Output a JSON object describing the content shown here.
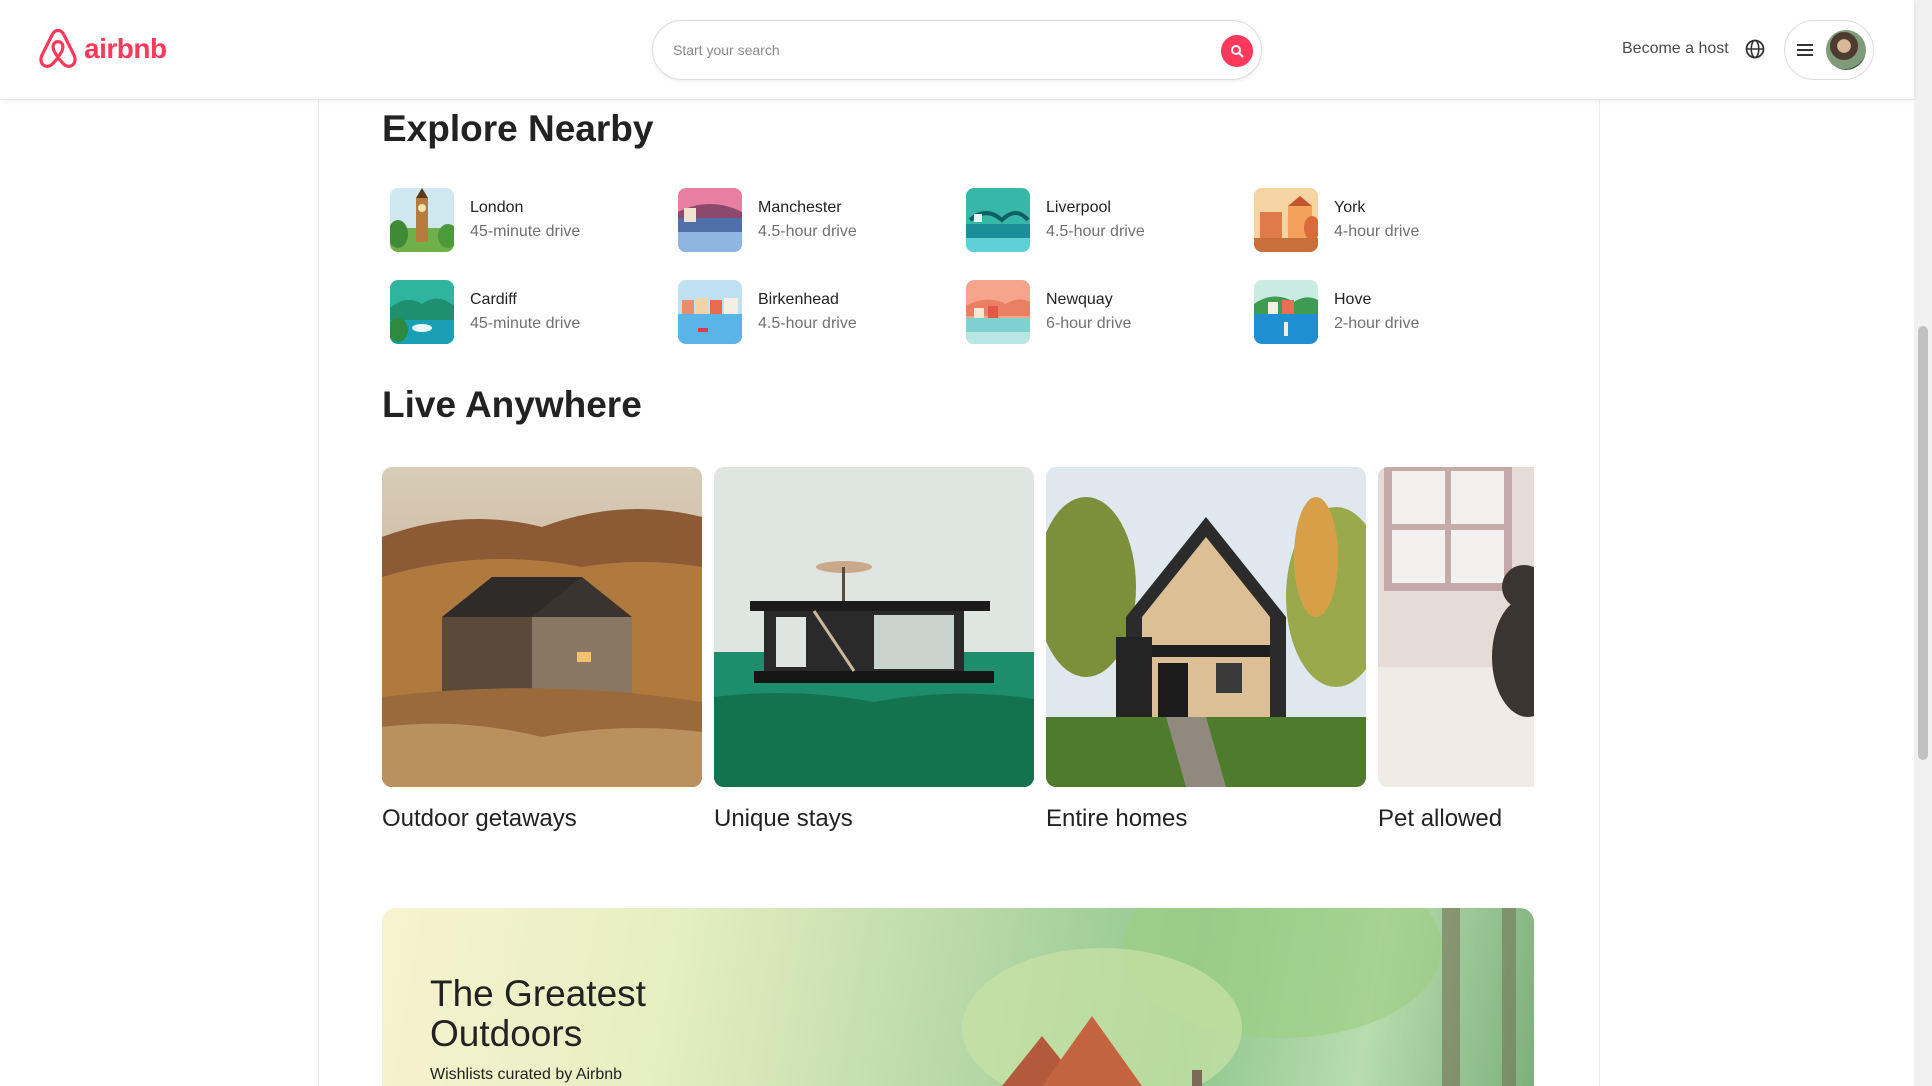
{
  "header": {
    "logo_text": "airbnb",
    "search_placeholder": "Start your search",
    "host_link": "Become a host"
  },
  "explore": {
    "title": "Explore Nearby",
    "items": [
      {
        "city": "London",
        "drive": "45-minute drive"
      },
      {
        "city": "Manchester",
        "drive": "4.5-hour drive"
      },
      {
        "city": "Liverpool",
        "drive": "4.5-hour drive"
      },
      {
        "city": "York",
        "drive": "4-hour drive"
      },
      {
        "city": "Cardiff",
        "drive": "45-minute drive"
      },
      {
        "city": "Birkenhead",
        "drive": "4.5-hour drive"
      },
      {
        "city": "Newquay",
        "drive": "6-hour drive"
      },
      {
        "city": "Hove",
        "drive": "2-hour drive"
      }
    ]
  },
  "live": {
    "title": "Live Anywhere",
    "cards": [
      {
        "label": "Outdoor getaways"
      },
      {
        "label": "Unique stays"
      },
      {
        "label": "Entire homes"
      },
      {
        "label": "Pet allowed"
      }
    ]
  },
  "banner": {
    "title_line1": "The Greatest",
    "title_line2": "Outdoors",
    "subtitle": "Wishlists curated by Airbnb"
  },
  "colors": {
    "brand": "#ff385c",
    "text": "#222222",
    "muted": "#717171"
  }
}
